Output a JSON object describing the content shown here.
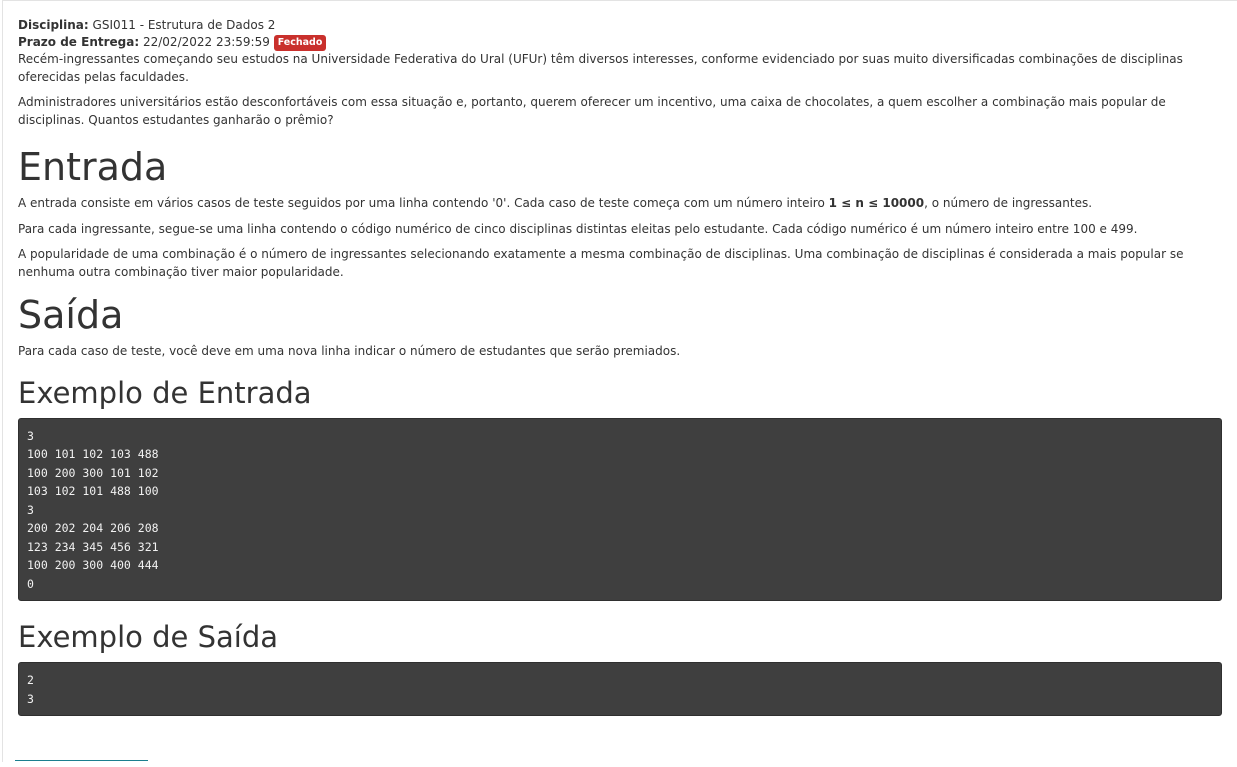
{
  "meta": {
    "discipline_label": "Disciplina:",
    "discipline_value": "GSI011 - Estrutura de Dados 2",
    "deadline_label": "Prazo de Entrega:",
    "deadline_value": "22/02/2022 23:59:59",
    "status_badge": "Fechado"
  },
  "intro": {
    "p1": "Recém-ingressantes começando seu estudos na Universidade Federativa do Ural (UFUr) têm diversos interesses, conforme evidenciado por suas muito diversificadas combinações de disciplinas oferecidas pelas faculdades.",
    "p2": "Administradores universitários estão desconfortáveis com essa situação e, portanto, querem oferecer um incentivo, uma caixa de chocolates, a quem escolher a combinação mais popular de disciplinas. Quantos estudantes ganharão o prêmio?"
  },
  "entrada": {
    "heading": "Entrada",
    "p1_before": "A entrada consiste em vários casos de teste seguidos por uma linha contendo '0'. Cada caso de teste começa com um número inteiro ",
    "p1_bold": "1 ≤ n ≤ 10000",
    "p1_after": ", o número de ingressantes.",
    "p2": "Para cada ingressante, segue-se uma linha contendo o código numérico de cinco disciplinas distintas eleitas pelo estudante. Cada código numérico é um número inteiro entre 100 e 499.",
    "p3": "A popularidade de uma combinação é o número de ingressantes selecionando exatamente a mesma combinação de disciplinas. Uma combinação de disciplinas é considerada a mais popular se nenhuma outra combinação tiver maior popularidade."
  },
  "saida": {
    "heading": "Saída",
    "p1": "Para cada caso de teste, você deve em uma nova linha indicar o número de estudantes que serão premiados."
  },
  "exemplo_entrada": {
    "heading": "Exemplo de Entrada",
    "code": "3\n100 101 102 103 488\n100 200 300 101 102\n103 102 101 488 100\n3\n200 202 204 206 208\n123 234 345 456 321\n100 200 300 400 444\n0"
  },
  "exemplo_saida": {
    "heading": "Exemplo de Saída",
    "code": "2\n3"
  }
}
